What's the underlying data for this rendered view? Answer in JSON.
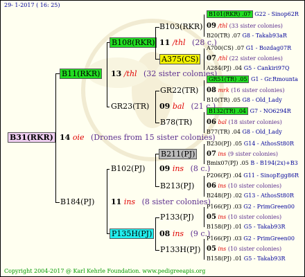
{
  "header": {
    "date": "29-  1-2017 ( 16: 25)"
  },
  "footer": {
    "copyright": "Copyright 2004-2017 @ Karl Kehrle Foundation.   www.pedigreeapis.org"
  },
  "root": {
    "label": "B31(RKR)",
    "gen": "14",
    "mark": "oie",
    "note": "(Drones from 15 sister colonies)"
  },
  "g1": [
    {
      "label": "B11(RKR)",
      "gen": "13",
      "mark": "/thl",
      "note": "(32 sister colonies)"
    },
    {
      "label": "B184(PJ)",
      "gen": "11",
      "mark": "ins",
      "note": "(8 sister colonies)"
    }
  ],
  "g2": [
    {
      "label": "B108(RKR)",
      "gen": "11",
      "mark": "/thl",
      "note": "(28 c.)"
    },
    {
      "label": "GR23(TR)",
      "gen": "09",
      "mark": "bal",
      "note": "(21 c.)"
    },
    {
      "label": "B102(PJ)",
      "gen": "09",
      "mark": "ins",
      "note": "(8 c.)"
    },
    {
      "label": "P135H(PJ)",
      "gen": "08",
      "mark": "ins",
      "note": "(9 c.)"
    }
  ],
  "g3": [
    {
      "label": "B103(RKR)"
    },
    {
      "label": "A375(CS)"
    },
    {
      "label": "GR22(TR)"
    },
    {
      "label": "B78(TR)"
    },
    {
      "label": "B211(PJ)"
    },
    {
      "label": "B213(PJ)"
    },
    {
      "label": "P133(PJ)"
    },
    {
      "label": "P133H(PJ)"
    }
  ],
  "g4": [
    {
      "a": "B101(RKR) .07",
      "b": "G22 - Sinop62R"
    },
    {
      "gen": "09",
      "mark": "/thl",
      "note": "(33 sister colonies)"
    },
    {
      "a": "B20(TR) .07",
      "b": "G8 - Takab93aR"
    },
    {
      "a": "A700(CS) .07",
      "b": "G1 - Bozdag07R"
    },
    {
      "gen": "07",
      "mark": "/thl",
      "note": "(22 sister colonies)"
    },
    {
      "a": "A284(PJ) .04",
      "b": "G5 - Cankiri97Q"
    },
    {
      "a": "GR51(TR) .05",
      "b": "G1 - Gr.Rmounta"
    },
    {
      "gen": "08",
      "mark": "mrk",
      "note": "(16 sister colonies)"
    },
    {
      "a": "B10(TR) .05",
      "b": "G8 - Old_Lady"
    },
    {
      "a": "B132(TR) .04",
      "b": "G7 - NO6294R"
    },
    {
      "gen": "06",
      "mark": "bal",
      "note": "(18 sister colonies)"
    },
    {
      "a": "B77(TR) .04",
      "b": "G8 - Old_Lady"
    },
    {
      "a": "B230(PJ) .05",
      "b": "G14 - AthosSt80R"
    },
    {
      "gen": "07",
      "mark": "ins",
      "note": "(9 sister colonies)"
    },
    {
      "a": "Bmix07(PJ) .05",
      "b": "B - B194(2x)+B3"
    },
    {
      "a": "P206(PJ) .04",
      "b": "G11 - SinopEgg86R"
    },
    {
      "gen": "06",
      "mark": "ins",
      "note": "(10 sister colonies)"
    },
    {
      "a": "B248(PJ) .02",
      "b": "G13 - AthosSt80R"
    },
    {
      "a": "P166(PJ) .03",
      "b": "G2 - PrimGreen00"
    },
    {
      "gen": "05",
      "mark": "ins",
      "note": "(10 sister colonies)"
    },
    {
      "a": "B158(PJ) .01",
      "b": "G5 - Takab93R"
    },
    {
      "a": "P166(PJ) .03",
      "b": "G2 - PrimGreen00"
    },
    {
      "gen": "05",
      "mark": "ins",
      "note": "(10 sister colonies)"
    },
    {
      "a": "B158(PJ) .01",
      "b": "G5 - Takab93R"
    }
  ]
}
